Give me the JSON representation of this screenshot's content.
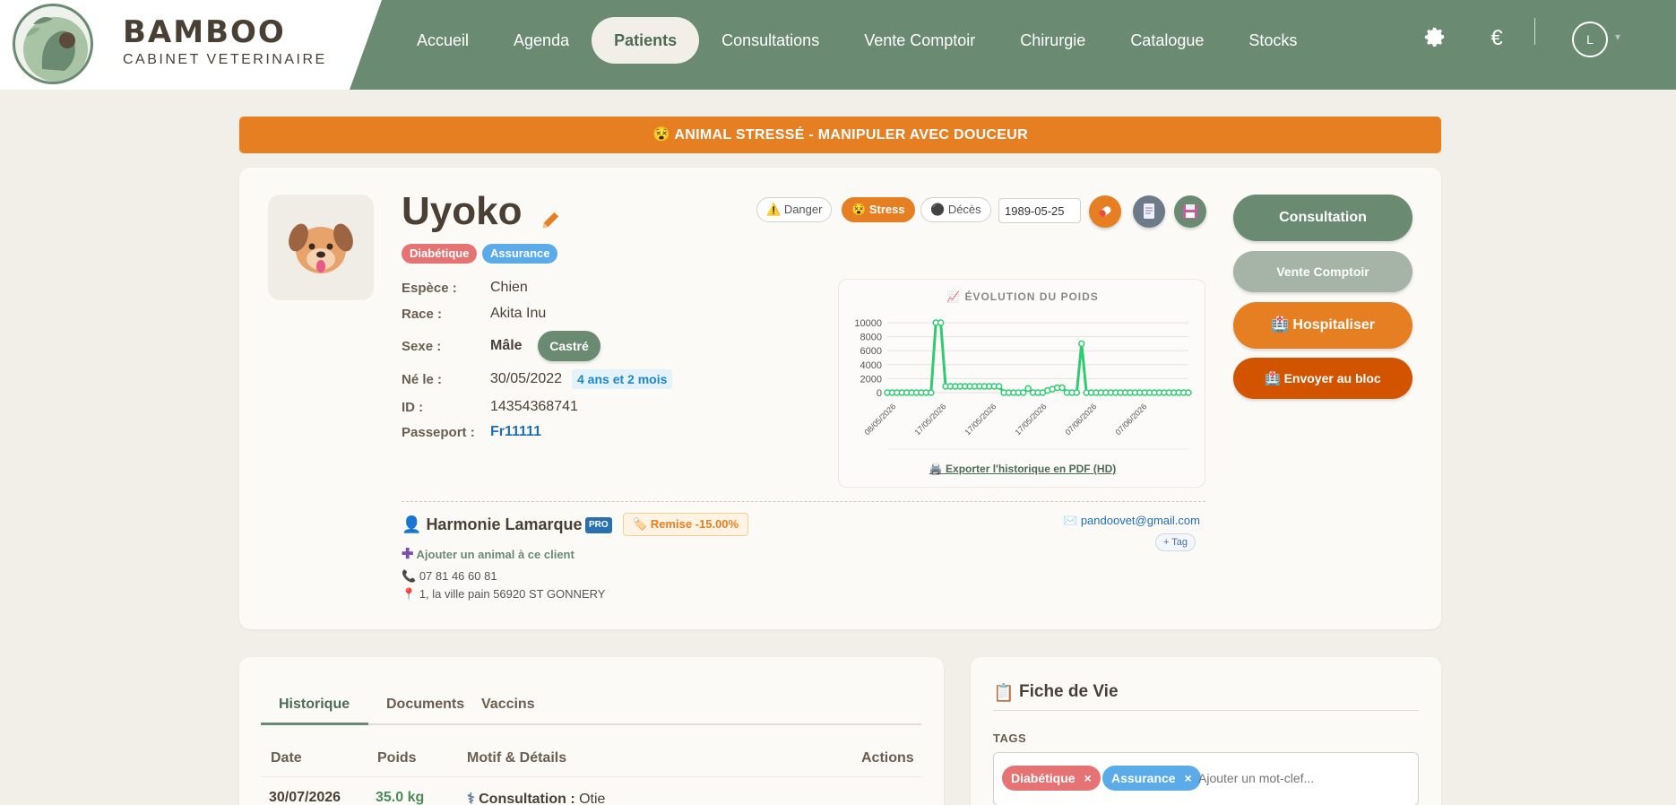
{
  "brand": {
    "name": "BAMBOO",
    "subtitle": "CABINET VETERINAIRE"
  },
  "nav": {
    "items": [
      "Accueil",
      "Agenda",
      "Patients",
      "Consultations",
      "Vente Comptoir",
      "Chirurgie",
      "Catalogue",
      "Stocks"
    ],
    "active": "Patients",
    "settings_icon": "gear-icon",
    "currency_icon": "€",
    "avatar_initial": "L"
  },
  "alert": {
    "text": "ANIMAL STRESSÉ - MANIPULER AVEC DOUCEUR",
    "color": "#e67e22"
  },
  "patient": {
    "name": "Uyoko",
    "tags": [
      "Diabétique",
      "Assurance"
    ],
    "fields": {
      "espece_label": "Espèce :",
      "espece": "Chien",
      "race_label": "Race :",
      "race": "Akita Inu",
      "sexe_label": "Sexe :",
      "sexe": "Mâle",
      "sterilisation": "Castré",
      "naissance_label": "Né le :",
      "naissance": "30/05/2022",
      "age": "4 ans et 2 mois",
      "id_label": "ID :",
      "id": "14354368741",
      "passeport_label": "Passeport :",
      "passeport": "Fr11111"
    },
    "status_toggles": [
      {
        "label": "Danger",
        "icon": "⚠️",
        "active": false
      },
      {
        "label": "Stress",
        "icon": "😵",
        "active": true
      },
      {
        "label": "Décès",
        "icon": "⚫",
        "active": false
      }
    ],
    "death_date_value": "1989-05-25"
  },
  "actions": {
    "consultation": "Consultation",
    "vente": "Vente Comptoir",
    "hospitaliser": "Hospitaliser",
    "bloc": "Envoyer au bloc"
  },
  "weight_chart": {
    "title": "📈 ÉVOLUTION DU POIDS",
    "export_label": "🖨️ Exporter l'historique en PDF (HD)"
  },
  "chart_data": {
    "type": "line",
    "title": "ÉVOLUTION DU POIDS",
    "xlabel": "",
    "ylabel": "",
    "ylim": [
      0,
      10000
    ],
    "yticks": [
      0,
      2000,
      4000,
      6000,
      8000,
      10000
    ],
    "xticks": [
      "08/05/2026",
      "17/05/2026",
      "17/05/2026",
      "17/05/2026",
      "07/06/2026",
      "07/06/2026"
    ],
    "grid": true,
    "series": [
      {
        "color": "#2ecc71",
        "values": [
          0,
          0,
          0,
          0,
          0,
          0,
          0,
          0,
          0,
          0,
          10000,
          10000,
          900,
          900,
          900,
          900,
          900,
          900,
          900,
          900,
          900,
          900,
          900,
          900,
          0,
          0,
          0,
          0,
          0,
          600,
          0,
          0,
          0,
          300,
          500,
          700,
          700,
          0,
          0,
          0,
          7000,
          0,
          0,
          0,
          0,
          0,
          0,
          0,
          0,
          0,
          0,
          0,
          0,
          0,
          0,
          0,
          0,
          0,
          0,
          0,
          0,
          0,
          0
        ]
      }
    ]
  },
  "owner": {
    "name": "Harmonie Lamarque",
    "pro": "PRO",
    "remise": "Remise -15.00%",
    "add_animal": "Ajouter un animal à ce client",
    "phone": "07 81 46 60 81",
    "address": "1, la ville pain 56920 ST GONNERY",
    "email": "pandoovet@gmail.com",
    "add_tag": "+ Tag"
  },
  "history": {
    "tabs": [
      "Historique",
      "Documents",
      "Vaccins"
    ],
    "columns": [
      "Date",
      "Poids",
      "Motif & Détails",
      "Actions"
    ],
    "rows": [
      {
        "date": "30/07/2026",
        "poids": "35.0 kg",
        "motif_label": "Consultation :",
        "motif": "Otie"
      }
    ]
  },
  "fiche": {
    "title": "Fiche de Vie",
    "tags_label": "TAGS",
    "tags": [
      {
        "label": "Diabétique",
        "color": "#e57373"
      },
      {
        "label": "Assurance",
        "color": "#5aabe8"
      }
    ],
    "tag_placeholder": "Ajouter un mot-clef..."
  }
}
